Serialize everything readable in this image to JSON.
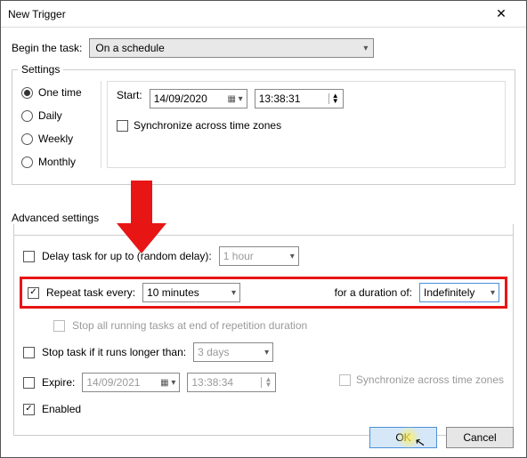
{
  "window": {
    "title": "New Trigger"
  },
  "begin": {
    "label": "Begin the task:",
    "value": "On a schedule"
  },
  "settings": {
    "legend": "Settings",
    "radios": {
      "one_time": "One time",
      "daily": "Daily",
      "weekly": "Weekly",
      "monthly": "Monthly"
    },
    "selected_radio": "one_time",
    "start_label": "Start:",
    "start_date": "14/09/2020",
    "start_time": "13:38:31",
    "sync_label": "Synchronize across time zones",
    "sync_checked": false
  },
  "advanced": {
    "legend": "Advanced settings",
    "delay": {
      "checked": false,
      "label": "Delay task for up to (random delay):",
      "value": "1 hour"
    },
    "repeat": {
      "checked": true,
      "label": "Repeat task every:",
      "value": "10 minutes",
      "duration_label": "for a duration of:",
      "duration_value": "Indefinitely"
    },
    "stop_all": {
      "checked": false,
      "label": "Stop all running tasks at end of repetition duration"
    },
    "stop_if": {
      "checked": false,
      "label": "Stop task if it runs longer than:",
      "value": "3 days"
    },
    "expire": {
      "checked": false,
      "label": "Expire:",
      "date": "14/09/2021",
      "time": "13:38:34",
      "sync_label": "Synchronize across time zones",
      "sync_checked": false
    },
    "enabled": {
      "checked": true,
      "label": "Enabled"
    }
  },
  "buttons": {
    "ok": "OK",
    "cancel": "Cancel"
  }
}
